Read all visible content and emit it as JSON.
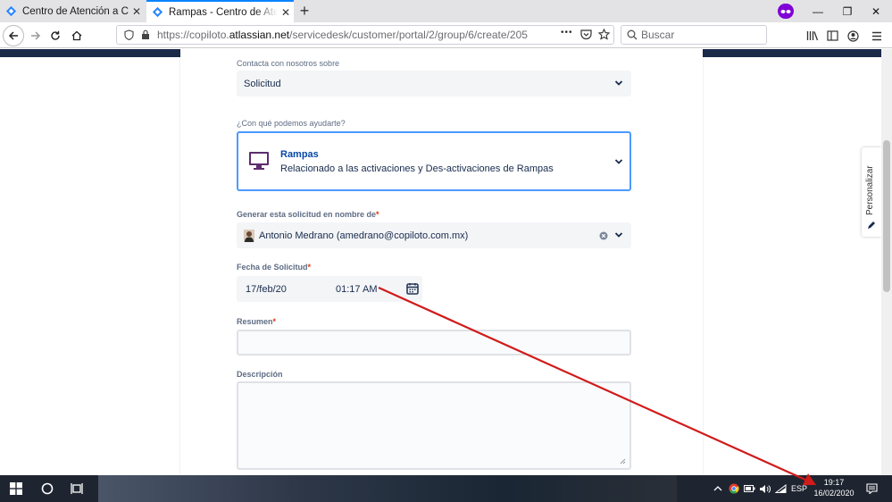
{
  "browser": {
    "tabs": [
      {
        "title": "Centro de Atención a Clientes"
      },
      {
        "title": "Rampas - Centro de Atención a Clientes"
      }
    ],
    "url": {
      "prefix": "https://copiloto.",
      "domain": "atlassian.net",
      "path": "/servicedesk/customer/portal/2/group/6/create/205"
    },
    "search_placeholder": "Buscar",
    "more_dots": "•••"
  },
  "form": {
    "contact_label": "Contacta con nosotros sobre",
    "contact_value": "Solicitud",
    "help_label": "¿Con qué podemos ayudarte?",
    "request_type": {
      "name": "Rampas",
      "description": "Relacionado a las activaciones y Des-activaciones de Rampas"
    },
    "on_behalf_label": "Generar esta solicitud en nombre de",
    "on_behalf_value": "Antonio Medrano (amedrano@copiloto.com.mx)",
    "date_label": "Fecha de Solicitud",
    "date_value": "17/feb/20",
    "time_value": "01:17 AM",
    "summary_label": "Resumen",
    "description_label": "Descripción",
    "required_mark": "*"
  },
  "side_tab": {
    "label": "Personalizar"
  },
  "taskbar": {
    "language": "ESP",
    "time": "19:17",
    "date": "16/02/2020"
  },
  "colors": {
    "accent": "#0747a6",
    "focus_border": "#4c9aff",
    "annotation_arrow": "#d11a1a",
    "required": "#de350b"
  }
}
